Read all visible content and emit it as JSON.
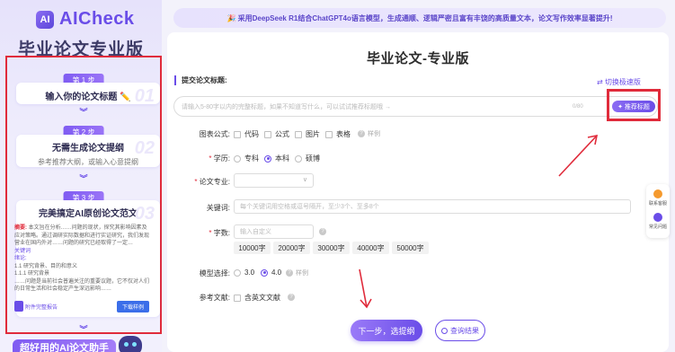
{
  "brand": {
    "logo_mark": "AI",
    "name": "AICheck",
    "subtitle": "毕业论文专业版"
  },
  "steps": [
    {
      "badge": "第 1 步",
      "title": "输入你的论文标题 ✏️",
      "num": "01"
    },
    {
      "badge": "第 2 步",
      "title": "无需生成论文提纲",
      "subtitle": "参考推荐大纲，或输入心意提纲",
      "num": "02"
    },
    {
      "badge": "第 3 步",
      "title": "完美搞定AI原创论文范文",
      "num": "03"
    }
  ],
  "abstract": {
    "label": "摘要:",
    "text": "本文旨在分析……问题的现状，探究其影响因素及应对策略。通过调研实际数据和进行实证研究，我们发现营业在国内外对……问题的研究已经取得了一定…",
    "keywords_label": "关键词",
    "intro_label": "绪论:",
    "lines": [
      "1.1 研究背景、目的和意义",
      "1.1.1 研究背景",
      "……问题是当前社会普遍关注的重要议题，它不仅对人们的日常生活和社会稳定产生深远影响……"
    ],
    "link": "附件完整报告",
    "download": "下载样例"
  },
  "left_bottom": "超好用的AI论文助手",
  "banner": "🎉 采用DeepSeek R1结合ChatGPT4o语言模型，生成通顺、逻辑严密且富有丰饶的高质量文本，论文写作效率显著提升!",
  "main": {
    "title": "毕业论文-专业版",
    "section_label": "提交论文标题:",
    "switch_label": "⇄ 切换极速版",
    "title_placeholder": "请输入5-80字以内的完整标题，如果不知道写什么，可以试试推荐标题哦 →",
    "count": "0/80",
    "recommend_label": "✦ 推荐标题"
  },
  "form": {
    "chart_label": "图表公式:",
    "chart_options": [
      "代码",
      "公式",
      "图片",
      "表格"
    ],
    "sample_label": "样例",
    "degree_label": "学历:",
    "degree_options": [
      "专科",
      "本科",
      "硕博"
    ],
    "major_label": "论文专业:",
    "major_caret": "∨",
    "keyword_label": "关键词:",
    "keyword_placeholder": "每个关键词用空格或逗号隔开，至少3个、至多8个",
    "words_label": "字数:",
    "words_placeholder": "输入自定义",
    "word_chips": [
      "10000字",
      "20000字",
      "30000字",
      "40000字",
      "50000字"
    ],
    "model_label": "模型选择:",
    "model_options": [
      "3.0",
      "4.0"
    ],
    "ref_label": "参考文献:",
    "ref_option": "含英文文献"
  },
  "actions": {
    "next": "下一步，选提纲",
    "query": "查询结果"
  },
  "float": {
    "service": "联系客服",
    "help": "常见问题"
  },
  "colors": {
    "accent": "#6a4de8",
    "highlight": "#e02b3b"
  }
}
